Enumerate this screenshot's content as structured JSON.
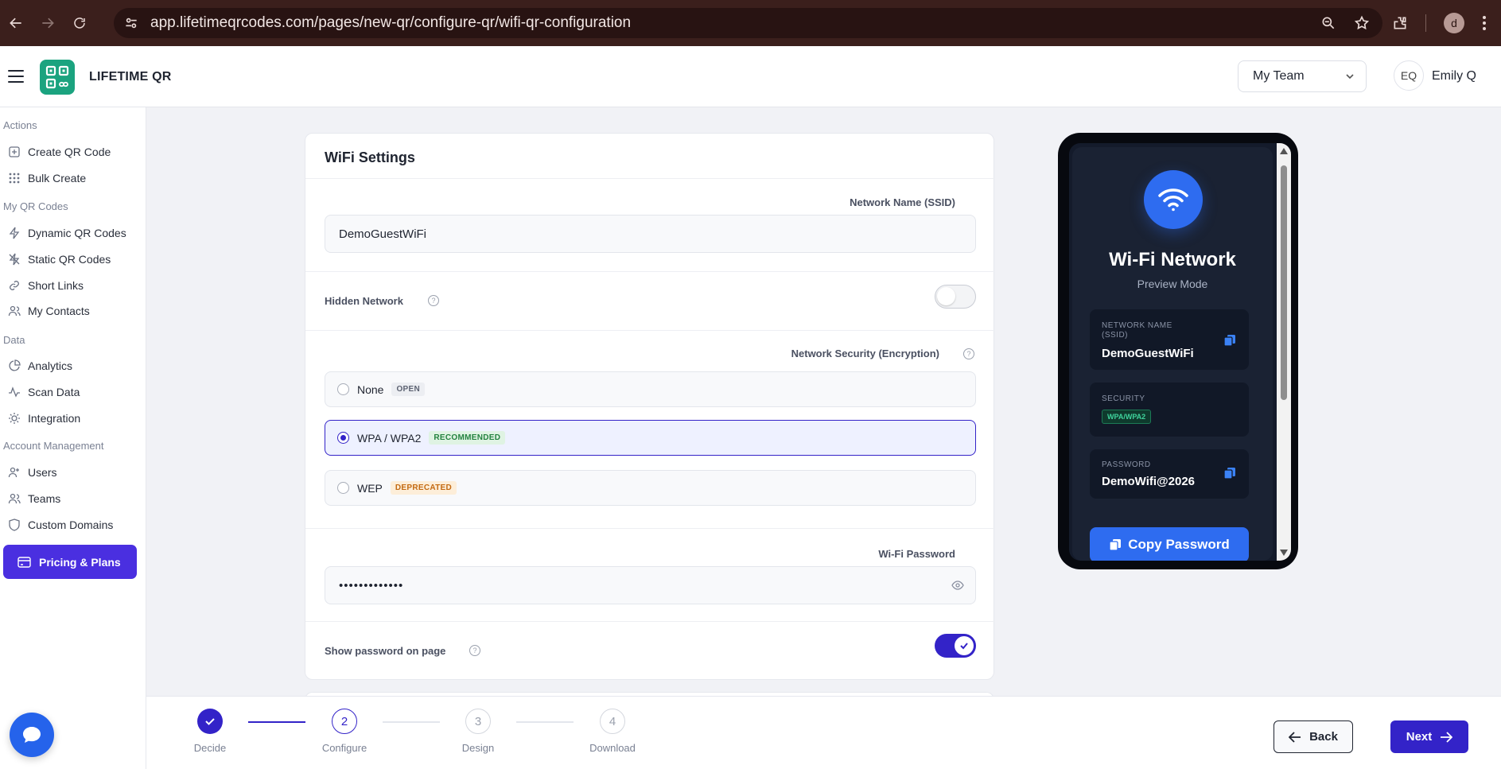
{
  "browser": {
    "url": "app.lifetimeqrcodes.com/pages/new-qr/configure-qr/wifi-qr-configuration",
    "profile_initial": "d"
  },
  "header": {
    "brand": "LIFETIME QR",
    "team_select": "My Team",
    "user_initials": "EQ",
    "user_name": "Emily Q"
  },
  "sidebar": {
    "sections": {
      "actions": "Actions",
      "my_qr_codes": "My QR Codes",
      "data": "Data",
      "account": "Account Management"
    },
    "items": {
      "create_qr": "Create QR Code",
      "bulk_create": "Bulk Create",
      "dynamic_qr": "Dynamic QR Codes",
      "static_qr": "Static QR Codes",
      "short_links": "Short Links",
      "my_contacts": "My Contacts",
      "analytics": "Analytics",
      "scan_data": "Scan Data",
      "integration": "Integration",
      "users": "Users",
      "teams": "Teams",
      "custom_domains": "Custom Domains"
    },
    "pricing": "Pricing & Plans"
  },
  "form": {
    "title": "WiFi Settings",
    "ssid_label": "Network Name (SSID)",
    "ssid_value": "DemoGuestWiFi",
    "hidden_label": "Hidden Network",
    "hidden_on": false,
    "security_label": "Network Security (Encryption)",
    "security_options": [
      {
        "label": "None",
        "badge": "OPEN",
        "selected": false
      },
      {
        "label": "WPA / WPA2",
        "badge": "RECOMMENDED",
        "selected": true
      },
      {
        "label": "WEP",
        "badge": "DEPRECATED",
        "selected": false
      }
    ],
    "password_label": "Wi-Fi Password",
    "password_masked": "•••••••••••••",
    "show_password_label": "Show password on page",
    "show_password_on": true
  },
  "preview": {
    "title": "Wi-Fi Network",
    "subtitle": "Preview Mode",
    "network_name_label": "NETWORK NAME (SSID)",
    "network_name_value": "DemoGuestWiFi",
    "security_label": "SECURITY",
    "security_value": "WPA/WPA2",
    "password_label": "PASSWORD",
    "password_value": "DemoWifi@2026",
    "copy_button": "Copy Password"
  },
  "stepper": {
    "steps": [
      {
        "num": "",
        "label": "Decide",
        "state": "done"
      },
      {
        "num": "2",
        "label": "Configure",
        "state": "current"
      },
      {
        "num": "3",
        "label": "Design",
        "state": "todo"
      },
      {
        "num": "4",
        "label": "Download",
        "state": "todo"
      }
    ],
    "back": "Back",
    "next": "Next"
  },
  "colors": {
    "accent": "#3323c8",
    "pricing_bg": "#4a2fe0",
    "browser_bg": "#3b1f1c",
    "preview_blue": "#2e6cf0"
  }
}
